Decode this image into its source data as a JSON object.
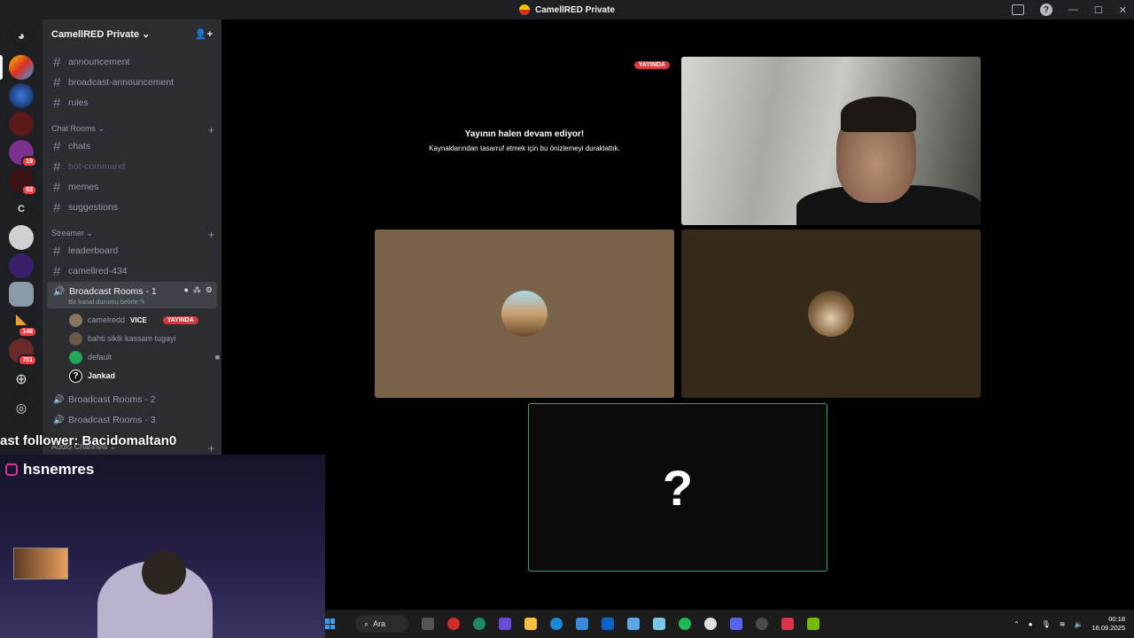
{
  "window": {
    "title": "CamellRED Private"
  },
  "server": {
    "name": "CamellRED Private"
  },
  "channels": {
    "top": [
      "announcement",
      "broadcast-announcement",
      "rules"
    ],
    "chat_category": "Chat Rooms",
    "chat": [
      "chats",
      "bot-command",
      "memes",
      "suggestions"
    ],
    "streamer_category": "Streamer",
    "streamer": [
      "leaderboard",
      "camellred-434"
    ],
    "voice_active": {
      "name": "Broadcast Rooms - 1",
      "status": "Bir kanal durumu belirle"
    },
    "members": [
      {
        "name": "camelredd",
        "tag": "VICE",
        "badge": "YAYINDA"
      },
      {
        "name": "bahti sikik kassam tugayi"
      },
      {
        "name": "default"
      },
      {
        "name": "Jankad"
      }
    ],
    "voice_other": [
      "Broadcast Rooms - 2",
      "Broadcast Rooms - 3"
    ],
    "audio_category": "Audio Channels"
  },
  "servers": {
    "badges": [
      "19",
      "63",
      "146",
      "751"
    ],
    "letter": "C"
  },
  "stream": {
    "badge": "YAYINDA",
    "title": "Yayının halen devam ediyor!",
    "subtitle": "Kaynaklarından tasarruf etmek için bu önizlemeyi duraklattık.",
    "unknown_tile": "?"
  },
  "overlay": {
    "follower_text": "ast follower: Bacidomaltan0",
    "instagram": "hsnemres"
  },
  "taskbar": {
    "search_label": "Ara",
    "time": "00:18",
    "date": "16.09.2025"
  }
}
